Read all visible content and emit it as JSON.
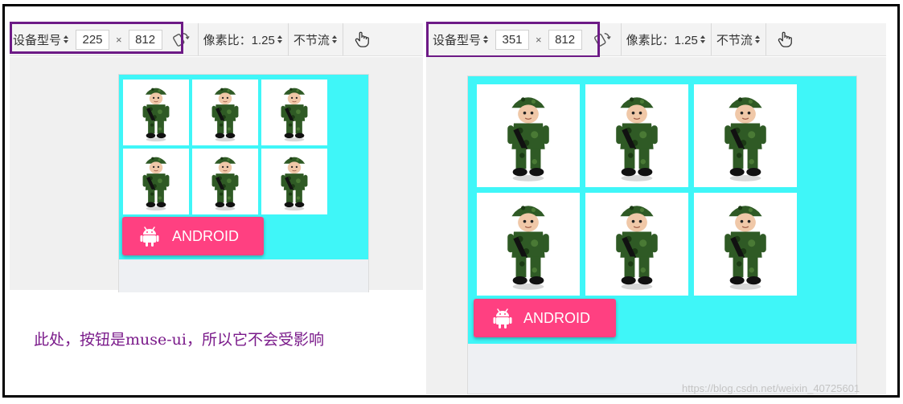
{
  "left_panel": {
    "toolbar": {
      "device_label": "设备型号",
      "width": "225",
      "times": "×",
      "height": "812",
      "pixel_ratio": "像素比：1.25",
      "throttle": "不节流"
    },
    "button_label": "ANDROID"
  },
  "right_panel": {
    "toolbar": {
      "device_label": "设备型号",
      "width": "351",
      "times": "×",
      "height": "812",
      "pixel_ratio": "像素比：1.25",
      "throttle": "不节流"
    },
    "button_label": "ANDROID"
  },
  "note": "此处，按钮是muse-ui，所以它不会受影响",
  "watermark": "https://blog.csdn.net/weixin_40725601",
  "icons": {
    "dropdown": "sort-arrows-icon",
    "rotate": "rotate-device-icon",
    "touch": "touch-hand-icon",
    "android": "android-robot-icon"
  },
  "colors": {
    "highlight": "#6d1a86",
    "cyan_bg": "#3ff6f8",
    "button": "#ff4081",
    "note_text": "#7a1a8a"
  }
}
